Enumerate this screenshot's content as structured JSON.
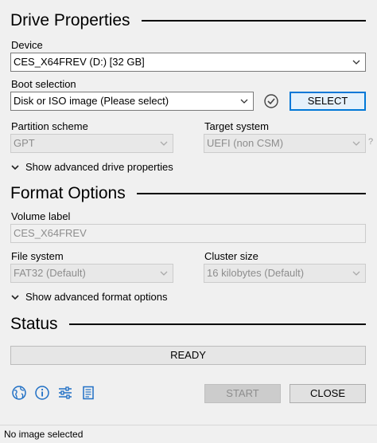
{
  "drive_properties": {
    "title": "Drive Properties",
    "device_label": "Device",
    "device_value": "CES_X64FREV (D:) [32 GB]",
    "boot_label": "Boot selection",
    "boot_value": "Disk or ISO image (Please select)",
    "select_button": "SELECT",
    "partition_label": "Partition scheme",
    "partition_value": "GPT",
    "target_label": "Target system",
    "target_value": "UEFI (non CSM)",
    "target_help": "?",
    "advanced_toggle": "Show advanced drive properties"
  },
  "format_options": {
    "title": "Format Options",
    "volume_label": "Volume label",
    "volume_value": "CES_X64FREV",
    "filesystem_label": "File system",
    "filesystem_value": "FAT32 (Default)",
    "cluster_label": "Cluster size",
    "cluster_value": "16 kilobytes (Default)",
    "advanced_toggle": "Show advanced format options"
  },
  "status": {
    "title": "Status",
    "progress_text": "READY",
    "start_button": "START",
    "close_button": "CLOSE",
    "bottom_text": "No image selected"
  },
  "icons": [
    "globe-icon",
    "info-icon",
    "settings-sliders-icon",
    "log-icon",
    "check-circle-icon",
    "chevron-down-icon"
  ],
  "colors": {
    "accent": "#0078d7",
    "background": "#f0f0f0"
  }
}
